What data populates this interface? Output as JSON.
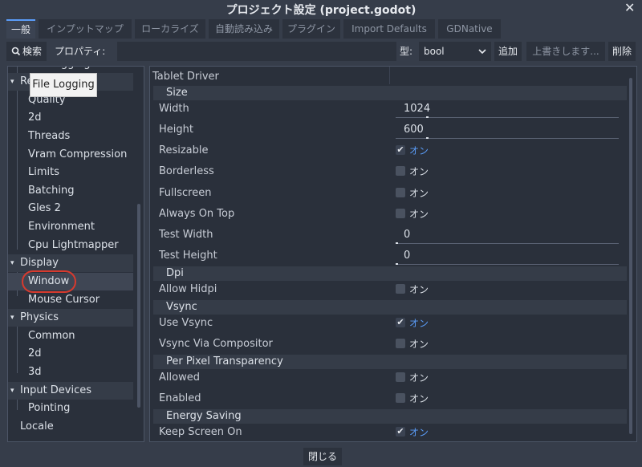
{
  "window": {
    "title": "プロジェクト設定 (project.godot)",
    "close_icon": "✕"
  },
  "tabs": [
    {
      "label": "一般"
    },
    {
      "label": "インプットマップ"
    },
    {
      "label": "ローカライズ"
    },
    {
      "label": "自動読み込み"
    },
    {
      "label": "プラグイン"
    },
    {
      "label": "Import Defaults"
    },
    {
      "label": "GDNative"
    }
  ],
  "toolbar": {
    "search_label": "検索",
    "property_label": "プロパティ:",
    "type_label": "型:",
    "type_value": "bool",
    "add_label": "追加",
    "overwrite_label": "上書きします...",
    "delete_label": "削除"
  },
  "tree": {
    "items": [
      {
        "label": "File Logging",
        "level": 1
      },
      {
        "label": "Rendering",
        "level": 0
      },
      {
        "label": "Quality",
        "level": 1
      },
      {
        "label": "2d",
        "level": 1
      },
      {
        "label": "Threads",
        "level": 1
      },
      {
        "label": "Vram Compression",
        "level": 1
      },
      {
        "label": "Limits",
        "level": 1
      },
      {
        "label": "Batching",
        "level": 1
      },
      {
        "label": "Gles 2",
        "level": 1
      },
      {
        "label": "Environment",
        "level": 1
      },
      {
        "label": "Cpu Lightmapper",
        "level": 1
      },
      {
        "label": "Display",
        "level": 0
      },
      {
        "label": "Window",
        "level": 1
      },
      {
        "label": "Mouse Cursor",
        "level": 1
      },
      {
        "label": "Physics",
        "level": 0
      },
      {
        "label": "Common",
        "level": 1
      },
      {
        "label": "2d",
        "level": 1
      },
      {
        "label": "3d",
        "level": 1
      },
      {
        "label": "Input Devices",
        "level": 0
      },
      {
        "label": "Pointing",
        "level": 1
      },
      {
        "label": "Locale",
        "level": 0
      }
    ],
    "selected": "Window"
  },
  "tooltip": "File Logging",
  "properties": {
    "tablet_driver": "Tablet Driver",
    "sections": [
      {
        "title": "Size"
      },
      {
        "title": "Dpi"
      },
      {
        "title": "Vsync"
      },
      {
        "title": "Per Pixel Transparency"
      },
      {
        "title": "Energy Saving"
      }
    ],
    "rows": [
      {
        "label": "Width",
        "value": "1024"
      },
      {
        "label": "Height",
        "value": "600"
      },
      {
        "label": "Resizable",
        "checked": true,
        "text": "オン"
      },
      {
        "label": "Borderless",
        "checked": false,
        "text": "オン"
      },
      {
        "label": "Fullscreen",
        "checked": false,
        "text": "オン"
      },
      {
        "label": "Always On Top",
        "checked": false,
        "text": "オン"
      },
      {
        "label": "Test Width",
        "value": "0"
      },
      {
        "label": "Test Height",
        "value": "0"
      },
      {
        "label": "Allow Hidpi",
        "checked": false,
        "text": "オン"
      },
      {
        "label": "Use Vsync",
        "checked": true,
        "text": "オン"
      },
      {
        "label": "Vsync Via Compositor",
        "checked": false,
        "text": "オン"
      },
      {
        "label": "Allowed",
        "checked": false,
        "text": "オン"
      },
      {
        "label": "Enabled",
        "checked": false,
        "text": "オン"
      },
      {
        "label": "Keep Screen On",
        "checked": true,
        "text": "オン"
      }
    ]
  },
  "footer": {
    "close_label": "閉じる"
  },
  "colors": {
    "accent": "#5a9cf8",
    "highlight_circle": "#d83a2e",
    "background": "#363d4a"
  }
}
